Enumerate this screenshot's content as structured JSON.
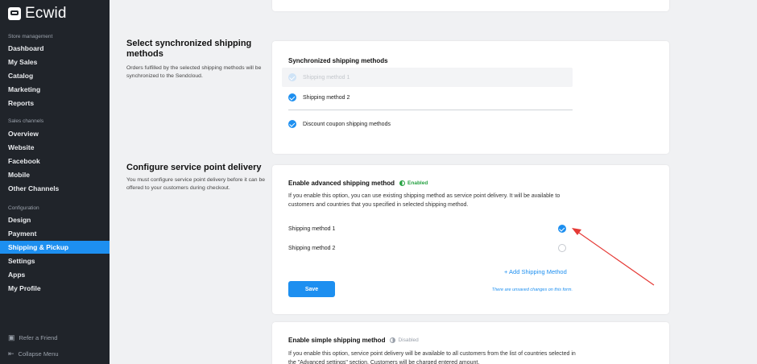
{
  "sidebar": {
    "logo_text": "Ecwid",
    "sections": {
      "store_management": "Store management",
      "sales_channels": "Sales channels",
      "configuration": "Configuration"
    },
    "store_items": [
      "Dashboard",
      "My Sales",
      "Catalog",
      "Marketing",
      "Reports"
    ],
    "sales_items": [
      "Overview",
      "Website",
      "Facebook",
      "Mobile",
      "Other Channels"
    ],
    "config_items": [
      "Design",
      "Payment",
      "Shipping & Pickup",
      "Settings",
      "Apps",
      "My Profile"
    ],
    "active_item": "Shipping & Pickup",
    "footer": {
      "refer": "Refer a Friend",
      "collapse": "Collapse Menu"
    }
  },
  "sync_section": {
    "title": "Select synchronized shipping methods",
    "description": "Orders fulfilled by the selected shipping methods will be synchronized to the Sendcloud.",
    "card_title": "Synchronized shipping methods",
    "items": [
      {
        "label": "Shipping method 1",
        "checked": true,
        "disabled": true
      },
      {
        "label": "Shipping method 2",
        "checked": true,
        "disabled": false
      },
      {
        "label": "Discount coupon shipping methods",
        "checked": true,
        "disabled": false
      }
    ]
  },
  "service_point": {
    "title": "Configure service point delivery",
    "description": "You must configure service point delivery before it can be offered to your customers during checkout.",
    "advanced": {
      "title": "Enable advanced shipping method",
      "status": "Enabled",
      "status_color": "#27a243",
      "description": "If you enable this option, you can use existing shipping method as service point delivery. It will be available to customers and countries that you specified in selected shipping method.",
      "methods": [
        {
          "label": "Shipping method 1",
          "selected": true
        },
        {
          "label": "Shipping method 2",
          "selected": false
        }
      ],
      "add_link": "+ Add Shipping Method",
      "save_label": "Save",
      "unsaved_note": "There are unsaved changes on this form."
    },
    "simple": {
      "title": "Enable simple shipping method",
      "status": "Disabled",
      "status_color": "#9aa1ab",
      "description": "If you enable this option, service point delivery will be available to all customers from the list of countries selected in the \"Advanced settings\" section. Customers will be charged entered amount."
    }
  },
  "colors": {
    "accent": "#1d8ff0",
    "sidebar_bg": "#20242a",
    "annotation_arrow": "#e53935"
  }
}
